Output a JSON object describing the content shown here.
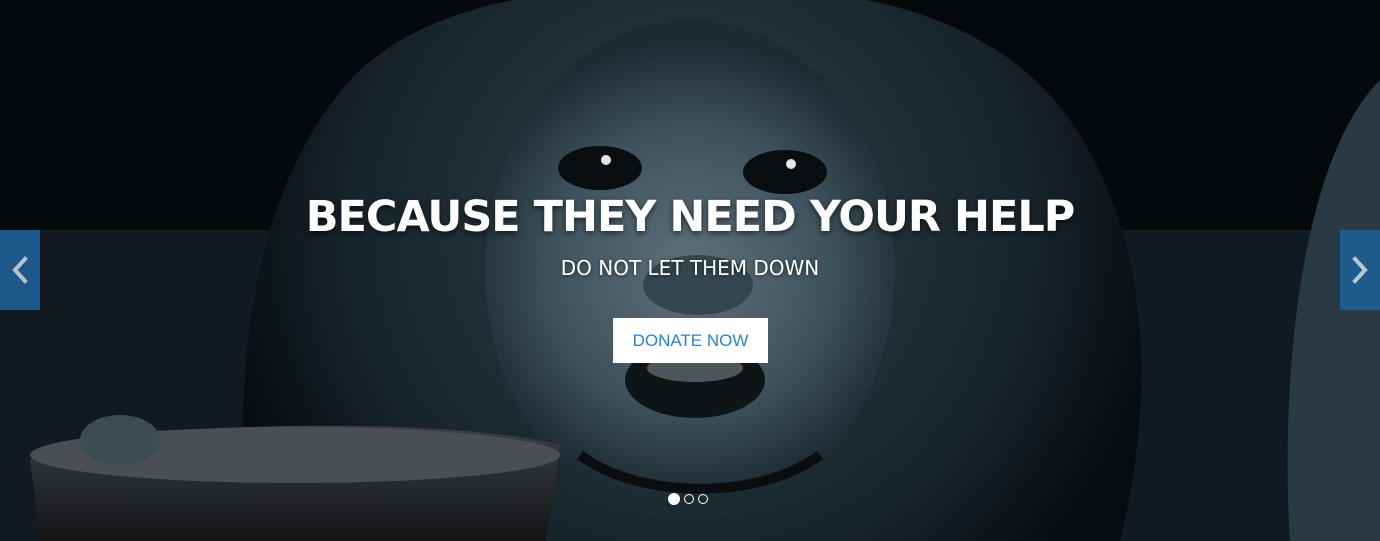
{
  "slide": {
    "headline": "BECAUSE THEY NEED YOUR HELP",
    "subline": "DO NOT LET THEM DOWN",
    "cta_label": "DONATE NOW"
  },
  "controls": {
    "prev_icon": "chevron-left-icon",
    "next_icon": "chevron-right-icon",
    "indicator_count": 3,
    "active_indicator": 1
  },
  "colors": {
    "arrow_bg": "#1f5e94",
    "cta_text": "#2b84c6",
    "cta_bg": "#ffffff",
    "text": "#ffffff"
  }
}
